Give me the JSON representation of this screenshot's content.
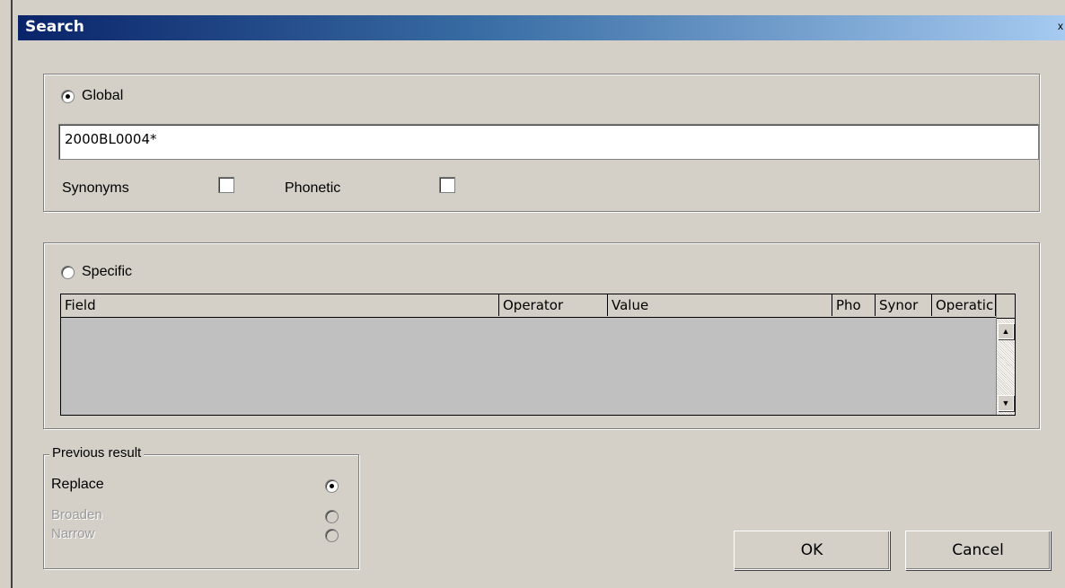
{
  "dialog": {
    "title": "Search",
    "close_glyph": "x"
  },
  "global": {
    "radio_label": "Global",
    "radio_checked": true,
    "query_value": "2000BL0004*",
    "synonyms_label": "Synonyms",
    "synonyms_checked": false,
    "phonetic_label": "Phonetic",
    "phonetic_checked": false
  },
  "specific": {
    "radio_label": "Specific",
    "radio_checked": false,
    "columns": [
      "Field",
      "Operator",
      "Value",
      "Pho",
      "Synor",
      "Operatic"
    ],
    "rows": []
  },
  "previous_result": {
    "legend": "Previous result",
    "options": [
      {
        "label": "Replace",
        "checked": true,
        "enabled": true
      },
      {
        "label": "Broaden",
        "checked": false,
        "enabled": false
      },
      {
        "label": "Narrow",
        "checked": false,
        "enabled": false
      }
    ]
  },
  "buttons": {
    "ok": "OK",
    "cancel": "Cancel"
  },
  "icons": {
    "scroll_up": "scroll-up-arrow-icon",
    "scroll_down": "scroll-down-arrow-icon"
  }
}
